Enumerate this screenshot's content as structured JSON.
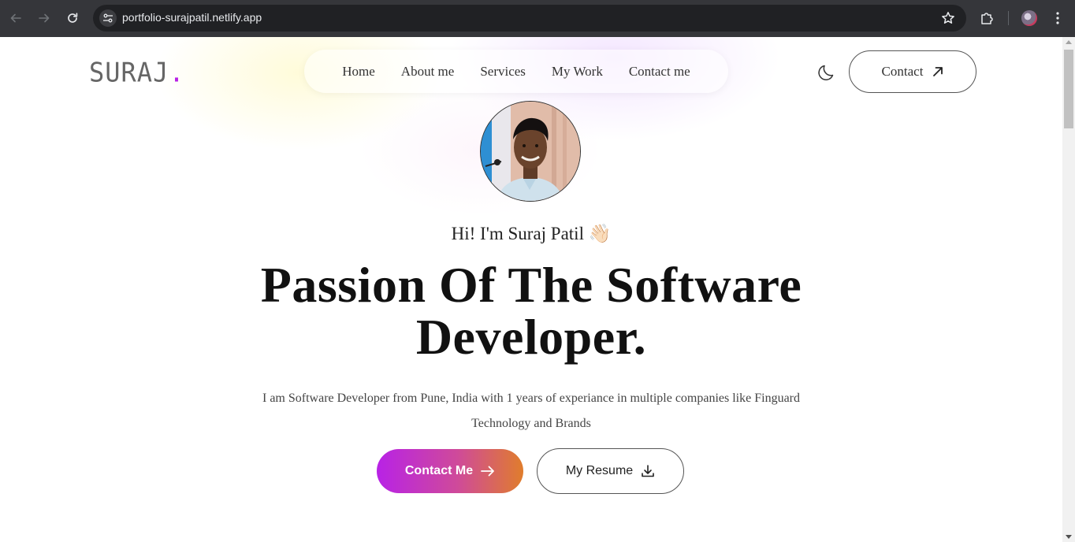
{
  "browser": {
    "url": "portfolio-surajpatil.netlify.app"
  },
  "header": {
    "logo_text": "SURAJ",
    "logo_dot": ".",
    "logo_dot_color": "#b820e6",
    "nav": [
      {
        "label": "Home"
      },
      {
        "label": "About me"
      },
      {
        "label": "Services"
      },
      {
        "label": "My Work"
      },
      {
        "label": "Contact me"
      }
    ],
    "contact_label": "Contact"
  },
  "hero": {
    "greeting": "Hi! I'm Suraj Patil",
    "greeting_emoji": "👋🏻",
    "headline_line1": "Passion Of The Software",
    "headline_line2": "Developer.",
    "description": "I am Software Developer from Pune, India with 1 years of experiance in multiple companies like Finguard Technology and Brands",
    "primary_button": "Contact Me",
    "secondary_button": "My Resume",
    "gradient_start": "#b822e6",
    "gradient_end": "#e07d2c"
  }
}
